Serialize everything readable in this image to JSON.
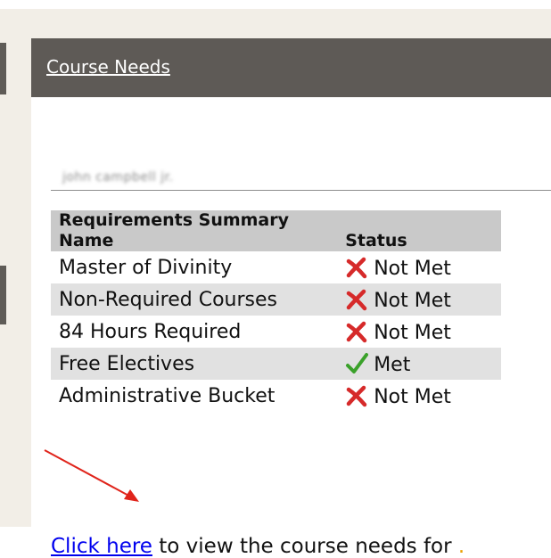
{
  "panel": {
    "title": "Course Needs",
    "student_name_blurred": "john campbell jr."
  },
  "table": {
    "headers": {
      "name": [
        "Requirements Summary",
        "Name"
      ],
      "status": "Status"
    },
    "rows": [
      {
        "name": "Master of Divinity",
        "status": "Not Met",
        "icon": "x-icon"
      },
      {
        "name": "Non-Required Courses",
        "status": "Not Met",
        "icon": "x-icon"
      },
      {
        "name": "84 Hours Required",
        "status": "Not Met",
        "icon": "x-icon"
      },
      {
        "name": "Free Electives",
        "status": "Met",
        "icon": "check-icon"
      },
      {
        "name": "Administrative Bucket",
        "status": "Not Met",
        "icon": "x-icon"
      }
    ]
  },
  "footer": {
    "link_text": "Click here",
    "rest_text": " to view the course needs for ",
    "trailing": "."
  },
  "colors": {
    "header_bg": "#5e5a56",
    "x_red": "#d62a2a",
    "check_green": "#3aa12a",
    "annotation_arrow": "#e0241b"
  }
}
